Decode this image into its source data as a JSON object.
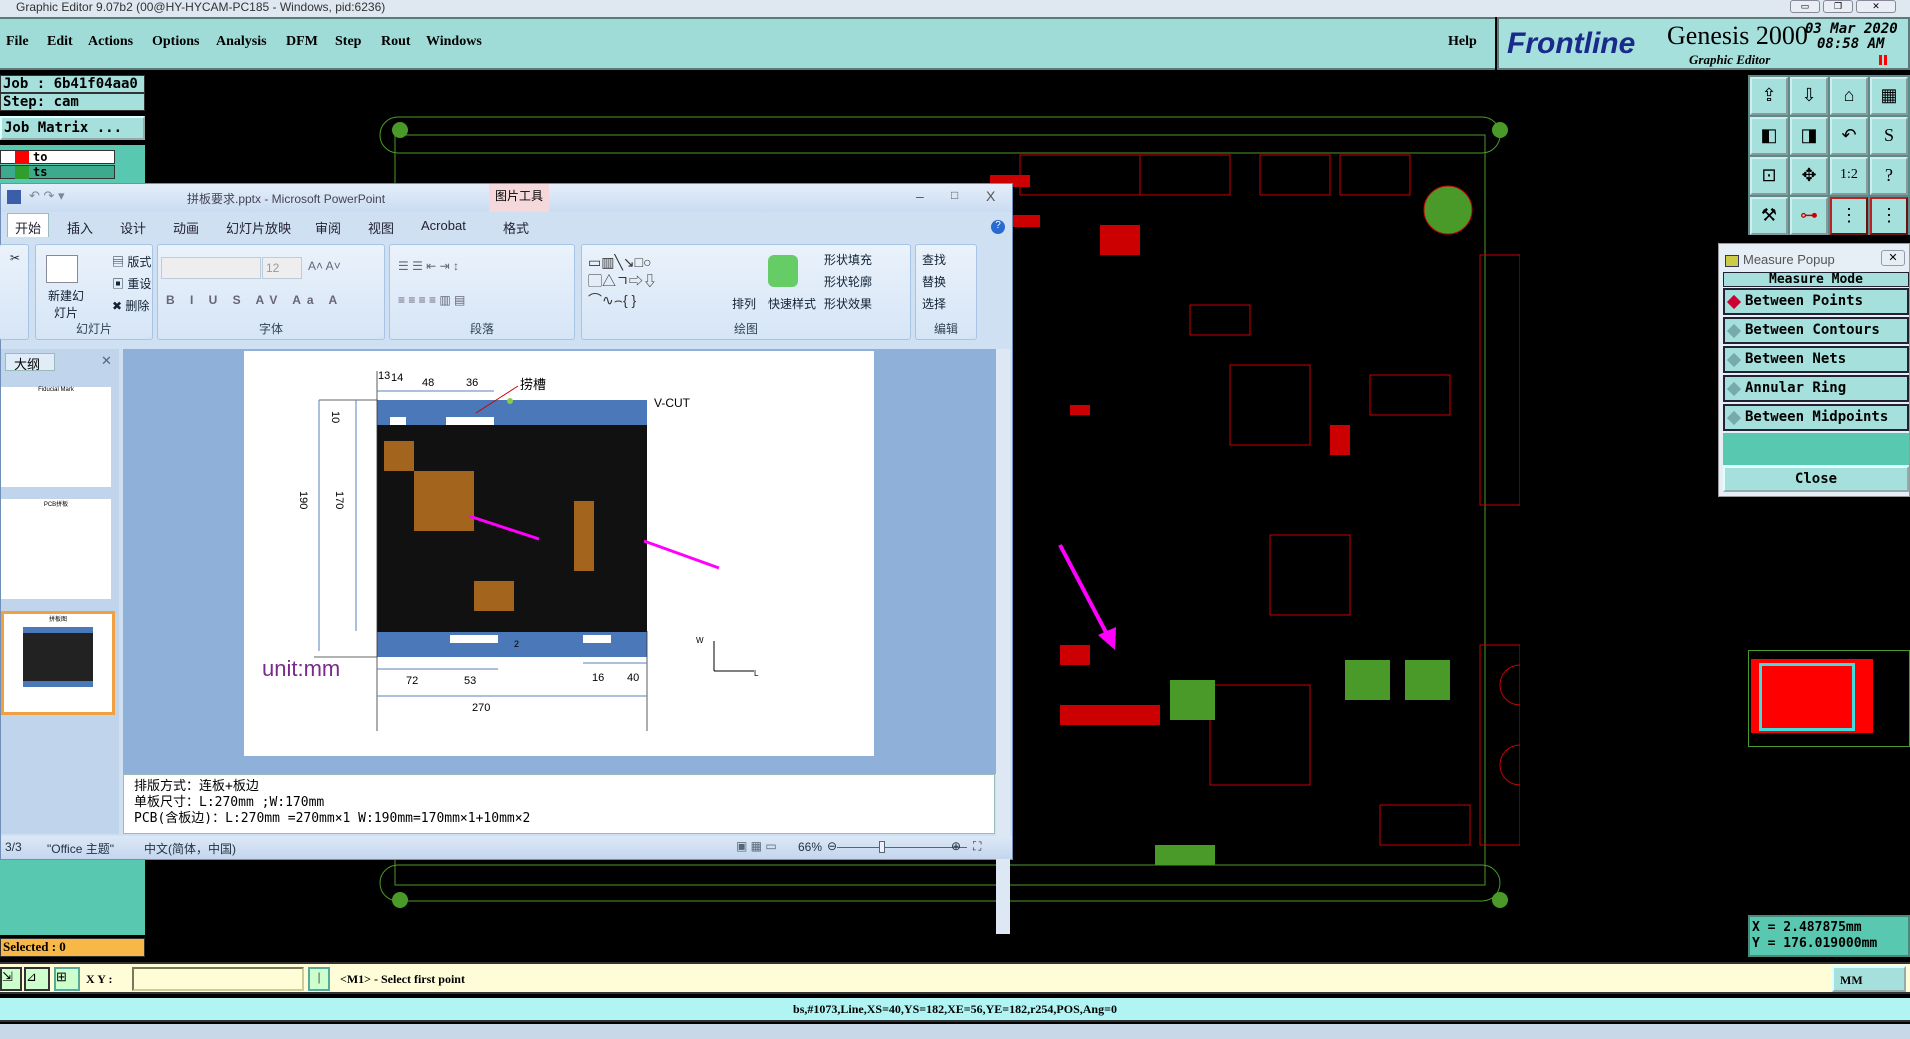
{
  "window": {
    "title": "Graphic Editor 9.07b2 (00@HY-HYCAM-PC185 - Windows, pid:6236)"
  },
  "menu": [
    "File",
    "Edit",
    "Actions",
    "Options",
    "Analysis",
    "DFM",
    "Step",
    "Rout",
    "Windows"
  ],
  "help": "Help",
  "brand": {
    "logo": "Frontline",
    "product": "Genesis 2000",
    "subtitle": "Graphic Editor",
    "date": "03 Mar 2020",
    "time": "08:58 AM"
  },
  "left_panel": {
    "job": "Job : 6b41f04aa0",
    "step": "Step: cam",
    "job_matrix": "Job Matrix ...",
    "layers": [
      {
        "name": "to",
        "color": "#ff0000"
      },
      {
        "name": "ts",
        "color": "#2e9e2e"
      }
    ],
    "selected": "Selected : 0"
  },
  "ppt": {
    "title": "拼板要求.pptx - Microsoft PowerPoint",
    "context_tab": "图片工具",
    "tabs": [
      "开始",
      "插入",
      "设计",
      "动画",
      "幻灯片放映",
      "审阅",
      "视图",
      "Acrobat",
      "格式"
    ],
    "groups": {
      "slides": "幻灯片",
      "font": "字体",
      "paragraph": "段落",
      "drawing": "绘图",
      "editing": "编辑"
    },
    "buttons": {
      "new_slide": "新建幻灯片",
      "layout": "版式",
      "reset": "重设",
      "delete": "删除",
      "font_size": "12",
      "arrange": "排列",
      "quick_styles": "快速样式",
      "shape_fill": "形状填充",
      "shape_outline": "形状轮廓",
      "shape_effects": "形状效果",
      "find": "查找",
      "replace": "替换",
      "select": "选择"
    },
    "outline_tab": "大纲",
    "thumbs": [
      "Fiducial Mark",
      "PCB拼板",
      "拼板图"
    ],
    "slide": {
      "dims": {
        "d13": "13",
        "d14": "14",
        "d48": "48",
        "d36": "36",
        "d10": "10",
        "d170": "170",
        "d190": "190",
        "d72": "72",
        "d53": "53",
        "d16": "16",
        "d40": "40",
        "d270": "270",
        "d2": "2"
      },
      "slot_label": "捞槽",
      "vcut": "V-CUT",
      "unit": "unit:mm",
      "axis_w": "W",
      "axis_l": "L"
    },
    "notes": [
      "排版方式：连板+板边",
      "单板尺寸：L:270mm ;W:170mm",
      "PCB(含板边)：L:270mm =270mm×1   W:190mm=170mm×1+10mm×2"
    ],
    "status": {
      "slide": "3/3",
      "theme": "\"Office 主题\"",
      "lang": "中文(简体，中国)",
      "zoom": "66%"
    }
  },
  "measure_popup": {
    "title": "Measure Popup",
    "header": "Measure Mode",
    "modes": [
      "Between Points",
      "Between Contours",
      "Between Nets",
      "Annular Ring",
      "Between Midpoints"
    ],
    "selected": 0,
    "close": "Close"
  },
  "coords": {
    "x": "X = 2.487875mm",
    "y": "Y = 176.019000mm"
  },
  "command": {
    "xy_label": "X Y :",
    "xy_value": "",
    "prompt": "<M1> - Select first point",
    "units": "MM"
  },
  "status_line": "bs,#1073,Line,XS=40,YS=182,XE=56,YE=182,r254,POS,Ang=0"
}
